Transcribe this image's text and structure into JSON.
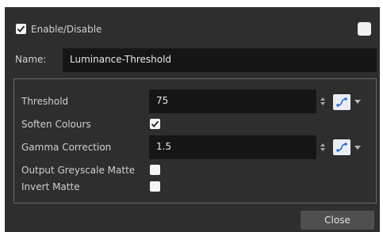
{
  "header": {
    "enable_label": "Enable/Disable",
    "enable_checked": true,
    "right_checkbox_checked": false
  },
  "name_row": {
    "label": "Name:",
    "value": "Luminance-Threshold"
  },
  "params": {
    "threshold": {
      "label": "Threshold",
      "value": "75"
    },
    "soften_colours": {
      "label": "Soften Colours",
      "checked": true
    },
    "gamma_correction": {
      "label": "Gamma Correction",
      "value": "1.5"
    },
    "output_greyscale_matte": {
      "label": "Output Greyscale Matte",
      "checked": false
    },
    "invert_matte": {
      "label": "Invert Matte",
      "checked": false
    }
  },
  "footer": {
    "close_label": "Close"
  },
  "icons": {
    "function_curve": "function-curve-icon",
    "spin_arrows": "spin-arrows-icon",
    "dropdown_arrow": "dropdown-arrow-icon"
  },
  "colors": {
    "background": "#2e2e2e",
    "field": "#161616",
    "accent_blue": "#2a6bd6"
  }
}
